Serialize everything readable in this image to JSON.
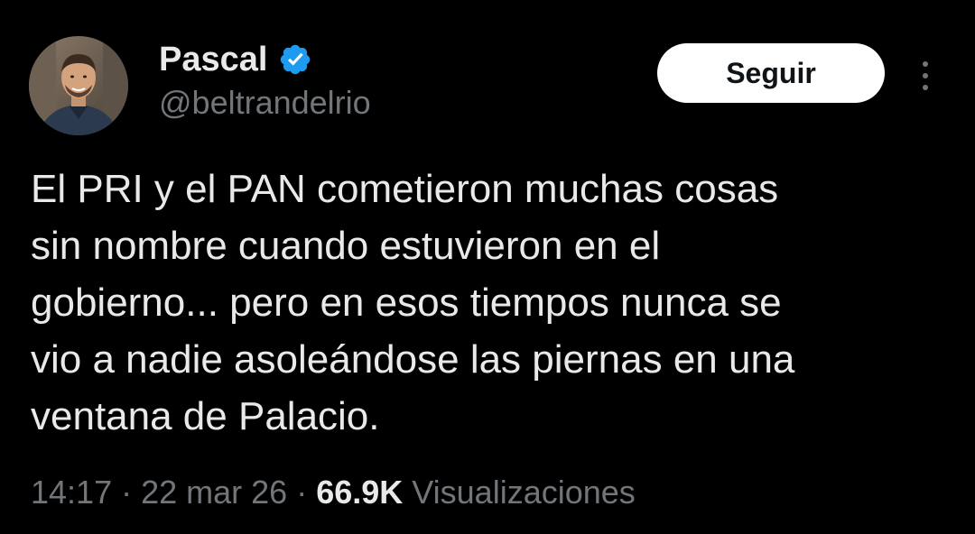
{
  "author": {
    "display_name": "Pascal",
    "handle": "@beltrandelrio",
    "verified": true,
    "verified_icon": "verified-badge-icon"
  },
  "actions": {
    "follow_label": "Seguir",
    "more_icon": "more-options-icon"
  },
  "tweet": {
    "text": "El PRI y el PAN cometieron muchas cosas\nsin nombre cuando estuvieron en el\ngobierno... pero en esos tiempos nunca se\nvio a nadie asoleándose las piernas en una\nventana de Palacio."
  },
  "meta": {
    "time": "14:17",
    "separator": "·",
    "date": "22 mar 26",
    "views_count": "66.9K",
    "views_label": "Visualizaciones"
  },
  "colors": {
    "background": "#000000",
    "primary_text": "#e7e9ea",
    "secondary_text": "#71767b",
    "verified_blue": "#1d9bf0",
    "button_bg": "#ffffff"
  }
}
